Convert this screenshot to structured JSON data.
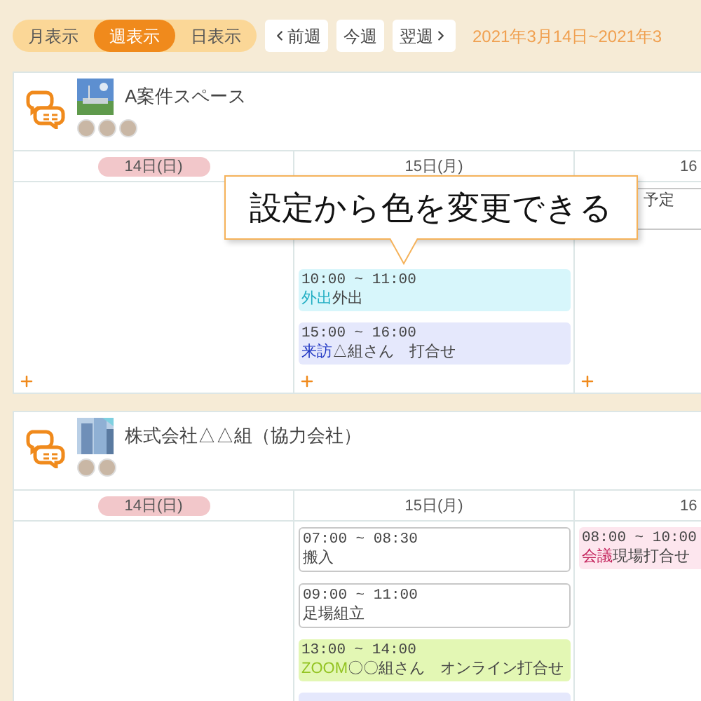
{
  "view_tabs": [
    {
      "label": "月表示",
      "selected": false
    },
    {
      "label": "週表示",
      "selected": true
    },
    {
      "label": "日表示",
      "selected": false
    }
  ],
  "nav_buttons": [
    {
      "label": "前週",
      "kind": "prev"
    },
    {
      "label": "今週",
      "kind": "plain"
    },
    {
      "label": "翌週",
      "kind": "next"
    }
  ],
  "date_range": "2021年3月14日~2021年3",
  "spaces": [
    {
      "name": "A案件スペース",
      "days": [
        {
          "label": "14日(日)",
          "holiday": true
        },
        {
          "label": "15日(月)",
          "holiday": false,
          "events": [
            {
              "time": "10:00 ~ 11:00",
              "tag": "外出",
              "title": "外出",
              "color": "#d7f6fb"
            },
            {
              "time": "15:00 ~ 16:00",
              "tag": "来訪",
              "title": "△組さん　打合せ",
              "color": "#e5e8fc"
            }
          ]
        },
        {
          "label": "16",
          "holiday": false,
          "events": [
            {
              "title": "予定"
            }
          ]
        }
      ]
    },
    {
      "name": "株式会社△△組（協力会社）",
      "days": [
        {
          "label": "14日(日)",
          "holiday": true
        },
        {
          "label": "15日(月)",
          "holiday": false,
          "events": [
            {
              "time": "07:00 ~ 08:30",
              "title": "搬入"
            },
            {
              "time": "09:00 ~ 11:00",
              "title": "足場組立"
            },
            {
              "time": "13:00 ~ 14:00",
              "tag": "ZOOM",
              "title": "〇〇組さん　オンライン打合せ",
              "color": "#e3f7b4"
            },
            {
              "color": "#e5e8fc"
            }
          ]
        },
        {
          "label": "16",
          "holiday": false,
          "events": [
            {
              "time": "08:00 ~ 10:00",
              "tag": "会議",
              "title": "現場打合せ",
              "color": "#fde6ee"
            }
          ]
        }
      ]
    }
  ],
  "callout": "設定から色を変更できる"
}
